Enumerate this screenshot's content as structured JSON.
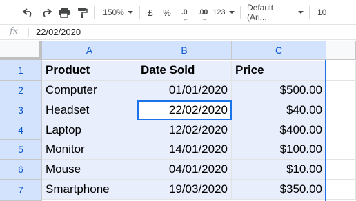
{
  "toolbar": {
    "undo_icon": "undo-icon",
    "redo_icon": "redo-icon",
    "print_icon": "print-icon",
    "paint_format_icon": "paint-format-icon",
    "zoom": "150%",
    "currency": "£",
    "percent": "%",
    "decrease_decimal": ".0",
    "increase_decimal": ".00",
    "more_formats": "123",
    "font": "Default (Ari...",
    "font_size": "10"
  },
  "formula_bar": {
    "fx_label": "fx",
    "value": "22/02/2020"
  },
  "grid": {
    "columns": [
      "A",
      "B",
      "C"
    ],
    "rows": [
      {
        "num": "1",
        "cells": [
          "Product",
          "Date Sold",
          "Price"
        ]
      },
      {
        "num": "2",
        "cells": [
          "Computer",
          "01/01/2020",
          "$500.00"
        ]
      },
      {
        "num": "3",
        "cells": [
          "Headset",
          "22/02/2020",
          "$40.00"
        ]
      },
      {
        "num": "4",
        "cells": [
          "Laptop",
          "12/02/2020",
          "$400.00"
        ]
      },
      {
        "num": "5",
        "cells": [
          "Monitor",
          "14/01/2020",
          "$100.00"
        ]
      },
      {
        "num": "6",
        "cells": [
          "Mouse",
          "04/01/2020",
          "$10.00"
        ]
      },
      {
        "num": "7",
        "cells": [
          "Smartphone",
          "19/03/2020",
          "$350.00"
        ]
      }
    ],
    "active_cell": "B3"
  },
  "colors": {
    "selection_border": "#1a73e8",
    "range_fill": "#e8eefc",
    "header_selected_fill": "#d3e3fd"
  }
}
